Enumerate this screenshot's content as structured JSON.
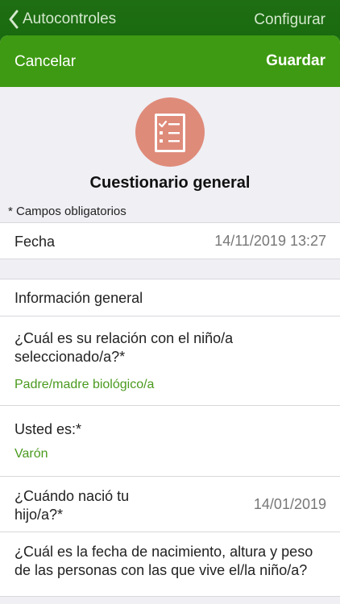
{
  "nav": {
    "back_label": "Autocontroles",
    "config_label": "Configurar"
  },
  "sheet_header": {
    "cancel_label": "Cancelar",
    "save_label": "Guardar"
  },
  "form": {
    "icon": "checklist-icon",
    "title": "Cuestionario general",
    "required_note": "* Campos obligatorios"
  },
  "fields": {
    "fecha": {
      "label": "Fecha",
      "value": "14/11/2019 13:27"
    },
    "section_title": "Información general",
    "relacion": {
      "label": "¿Cuál es su relación con el niño/a seleccionado/a?*",
      "value": "Padre/madre biológico/a"
    },
    "usted_es": {
      "label": "Usted es:*",
      "value": "Varón"
    },
    "nacimiento": {
      "label": "¿Cuándo nació tu hijo/a?*",
      "value": "14/01/2019"
    },
    "convivientes": {
      "label": "¿Cuál es la fecha de nacimiento, altura y peso de las personas con las que vive el/la niño/a?"
    }
  },
  "colors": {
    "header_green": "#3e9a12",
    "nav_green": "#1a6d10",
    "value_green": "#4a9a1e",
    "icon_circle": "#df8b7a"
  }
}
